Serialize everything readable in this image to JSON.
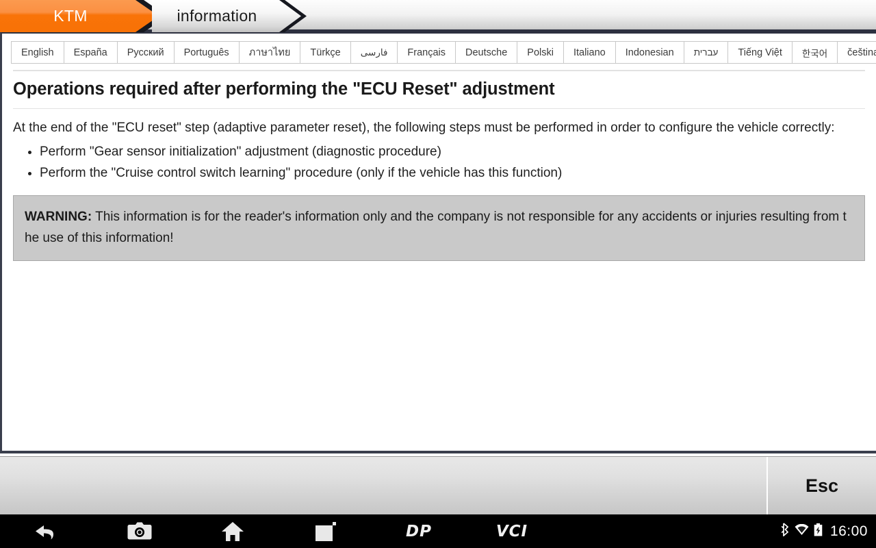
{
  "window": {
    "tabs": [
      {
        "label": "KTM",
        "active": true
      },
      {
        "label": "information",
        "active": false
      }
    ]
  },
  "languages": [
    {
      "label": "English",
      "selected": true
    },
    {
      "label": "España",
      "selected": false
    },
    {
      "label": "Русский",
      "selected": false
    },
    {
      "label": "Português",
      "selected": false
    },
    {
      "label": "ภาษาไทย",
      "selected": false
    },
    {
      "label": "Türkçe",
      "selected": false
    },
    {
      "label": "فارسی",
      "selected": false
    },
    {
      "label": "Français",
      "selected": false
    },
    {
      "label": "Deutsche",
      "selected": false
    },
    {
      "label": "Polski",
      "selected": false
    },
    {
      "label": "Italiano",
      "selected": false
    },
    {
      "label": "Indonesian",
      "selected": false
    },
    {
      "label": "עברית",
      "selected": false
    },
    {
      "label": "Tiếng Việt",
      "selected": false
    },
    {
      "label": "한국어",
      "selected": false
    },
    {
      "label": "čeština",
      "selected": false
    }
  ],
  "article": {
    "title": "Operations required after performing the \"ECU Reset\" adjustment",
    "intro": "At the end of the \"ECU reset\" step (adaptive parameter reset), the following steps must be performed in order to configure the vehicle correctly:",
    "steps": [
      "Perform \"Gear sensor initialization\" adjustment (diagnostic procedure)",
      "Perform the \"Cruise control switch learning\" procedure (only if the vehicle has this function)"
    ],
    "warning_label": "WARNING:",
    "warning_text": " This information is for the reader's information only and the company is not responsible for any accidents or injuries resulting from the use of this information!"
  },
  "toolbar": {
    "esc_label": "Esc"
  },
  "navbar": {
    "icons": [
      "back-icon",
      "camera-icon",
      "home-icon",
      "recent-apps-icon"
    ],
    "brand_dp": "DP",
    "brand_vci": "VCI",
    "status_icons": [
      "bluetooth-icon",
      "wifi-icon",
      "battery-charging-icon"
    ],
    "clock": "16:00"
  },
  "colors": {
    "accent_orange": "#f97308",
    "tab_dark": "#2d3140",
    "warning_bg": "#c9c9c9"
  }
}
